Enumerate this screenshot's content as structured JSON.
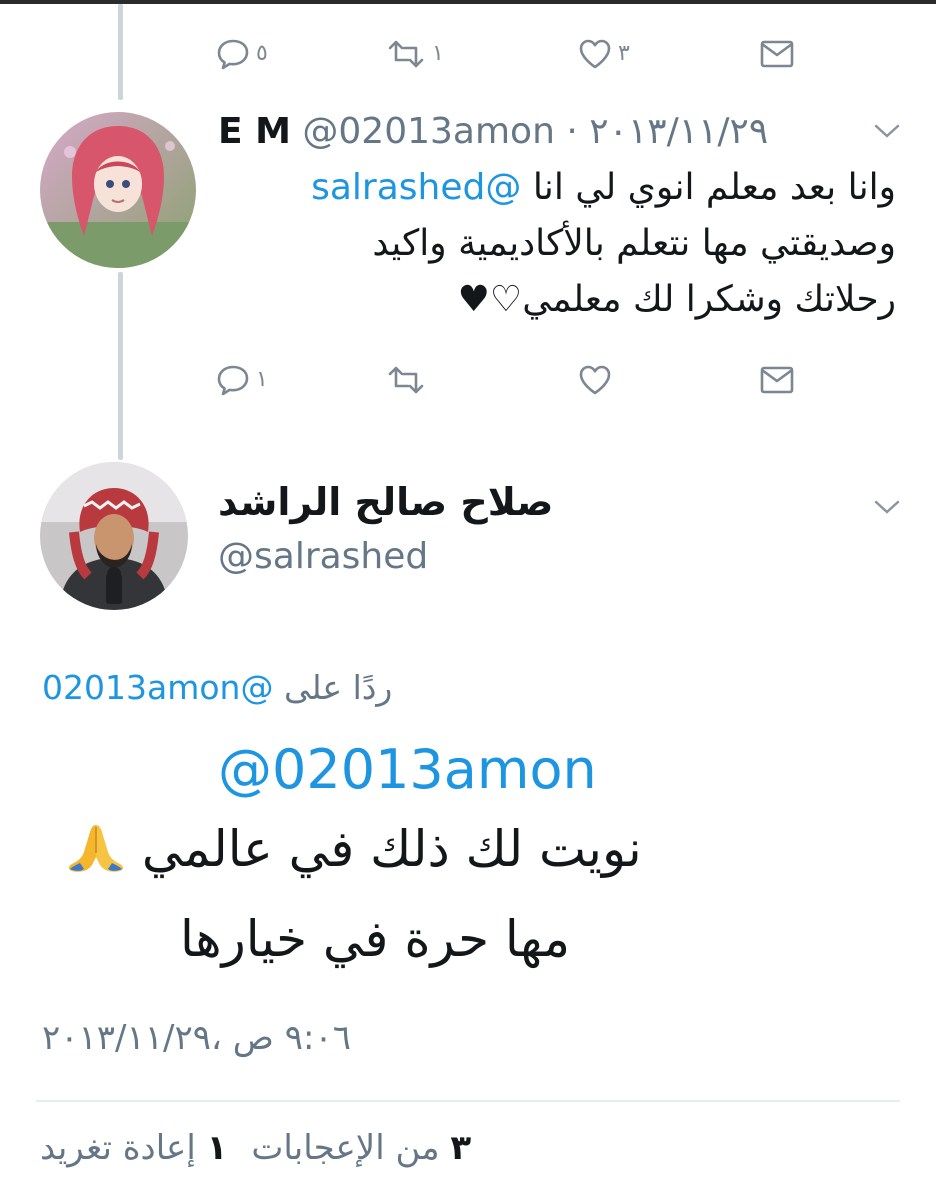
{
  "tweet_top": {
    "reply_count": "٥",
    "retweet_count": "١",
    "like_count": "٣"
  },
  "tweet_em": {
    "name": "E M",
    "handle": "@02013amon",
    "separator": "·",
    "date": "٢٠١٣/١١/٢٩",
    "mention": "@salrashed",
    "text_line1": "وانا بعد معلم انوي لي انا",
    "text_line2": "وصديقتي مها نتعلم بالأكاديمية واكيد",
    "text_line3": "رحلاتك وشكرا لك معلمي♡♥",
    "reply_count": "١"
  },
  "tweet_main": {
    "name": "صلاح صالح الراشد",
    "handle": "@salrashed",
    "reply_to_label": "ردًا على",
    "reply_to_handle": "@02013amon",
    "mention": "@02013amon",
    "line1": "نويت لك ذلك في عالمي",
    "line2": "مها حرة في خيارها",
    "timestamp": "٩:٠٦ ص ،٢٠١٣/١١/٢٩",
    "likes_count": "٣",
    "likes_label": "من الإعجابات",
    "retweets_count": "١",
    "retweets_label": "إعادة تغريد"
  },
  "icons": [
    "reply-icon",
    "retweet-icon",
    "like-icon",
    "message-icon",
    "chevron-down-icon",
    "pray-emoji-icon"
  ],
  "colors": {
    "link": "#1d95e0",
    "secondary_text": "#657786",
    "thread_line": "#cdd5dc"
  }
}
